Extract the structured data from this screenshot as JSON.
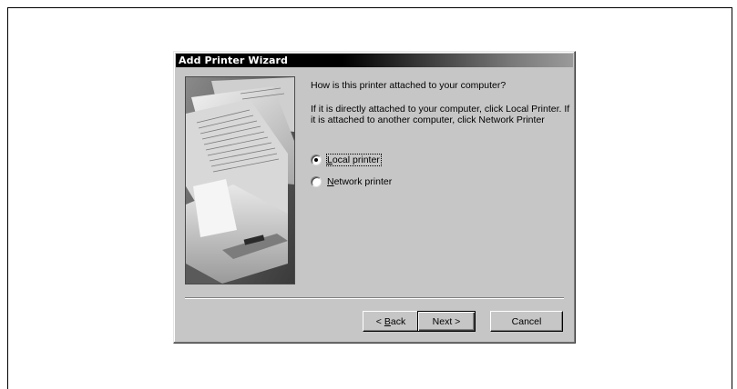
{
  "dialog": {
    "title": "Add Printer Wizard",
    "question": "How is this printer attached to your computer?",
    "explanation": "If it is directly attached to your computer, click Local Printer. If it is attached to another computer, click Network Printer",
    "options": [
      {
        "label": "Local printer",
        "mnemonic": "L",
        "rest": "ocal printer",
        "selected": true
      },
      {
        "label": "Network printer",
        "mnemonic": "N",
        "rest": "etwork printer",
        "selected": false
      }
    ],
    "buttons": {
      "back_prefix": "< ",
      "back_mnemonic": "B",
      "back_rest": "ack",
      "next": "Next >",
      "cancel": "Cancel"
    }
  }
}
